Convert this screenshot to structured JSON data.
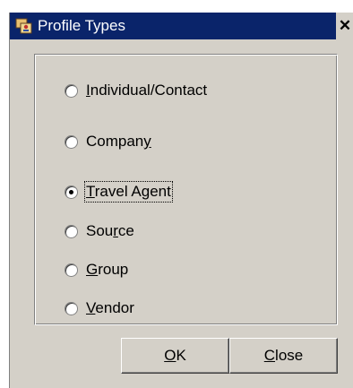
{
  "window": {
    "title": "Profile Types",
    "close_glyph": "✕",
    "icon": "profile-app-icon"
  },
  "profile_types": {
    "selected": "Travel Agent",
    "options": [
      {
        "pre": "",
        "key": "I",
        "post": "ndividual/Contact",
        "selected": false
      },
      {
        "pre": "Compan",
        "key": "y",
        "post": "",
        "selected": false
      },
      {
        "pre": "",
        "key": "T",
        "post": "ravel Agent",
        "selected": true
      },
      {
        "pre": "Sou",
        "key": "r",
        "post": "ce",
        "selected": false
      },
      {
        "pre": "",
        "key": "G",
        "post": "roup",
        "selected": false
      },
      {
        "pre": "",
        "key": "V",
        "post": "endor",
        "selected": false
      }
    ]
  },
  "buttons": {
    "ok": {
      "pre": "",
      "key": "O",
      "post": "K"
    },
    "close": {
      "pre": "",
      "key": "C",
      "post": "lose"
    }
  },
  "colors": {
    "titlebar": "#0a246a",
    "face": "#d4d0c8"
  }
}
